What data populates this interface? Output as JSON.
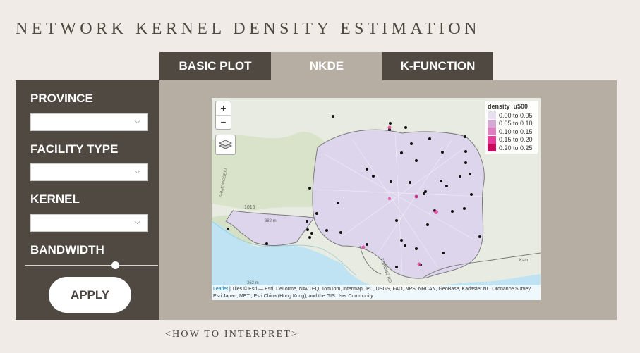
{
  "page": {
    "title": "NETWORK KERNEL DENSITY ESTIMATION"
  },
  "tabs": [
    {
      "label": "BASIC PLOT",
      "active": false
    },
    {
      "label": "NKDE",
      "active": true
    },
    {
      "label": "K-FUNCTION",
      "active": false
    }
  ],
  "sidebar": {
    "province_label": "PROVINCE",
    "province_value": "",
    "facility_label": "FACILITY TYPE",
    "facility_value": "",
    "kernel_label": "KERNEL",
    "kernel_value": "",
    "bandwidth_label": "BANDWIDTH",
    "bandwidth_value_fraction": 0.68,
    "apply_label": "APPLY"
  },
  "map": {
    "zoom_in": "+",
    "zoom_out": "−",
    "legend": {
      "title": "density_u500",
      "items": [
        {
          "label": "0.00 to 0.05",
          "color": "#e6dff0"
        },
        {
          "label": "0.05 to 0.10",
          "color": "#d3a8d3"
        },
        {
          "label": "0.10 to 0.15",
          "color": "#de7fbf"
        },
        {
          "label": "0.15 to 0.20",
          "color": "#e33d99"
        },
        {
          "label": "0.20 to 0.25",
          "color": "#c90a5e"
        }
      ]
    },
    "attribution_link": "Leaflet",
    "attribution_text": " | Tiles © Esri — Esri, DeLorme, NAVTEQ, TomTom, Intermap, iPC, USGS, FAO, NPS, NRCAN, GeoBase, Kadaster NL, Ordnance Survey, Esri Japan, METI, Esri China (Hong Kong), and the GIS User Community",
    "labels": {
      "place1": "SHIMONOSEKI",
      "place2": "1015",
      "place3": "382 m",
      "place4": "TORONG RD",
      "place5": "362 m",
      "place6": "Kam"
    }
  },
  "footer": {
    "howto": "<HOW TO INTERPRET>"
  },
  "colors": {
    "dark": "#4f4942",
    "panel": "#b6ada3",
    "bg": "#f0ebe6",
    "network": "#ddd5ec",
    "water": "#bfe3f2",
    "point": "#111111"
  }
}
